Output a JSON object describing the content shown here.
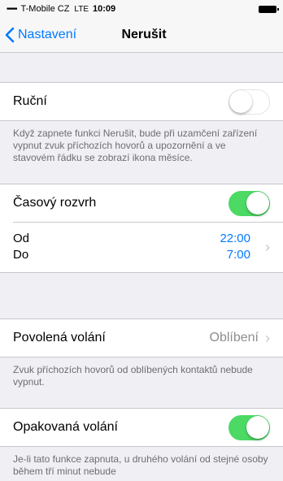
{
  "status_bar": {
    "signal": "•••••",
    "carrier": "T-Mobile CZ",
    "network": "LTE",
    "time": "10:09"
  },
  "nav": {
    "back_label": "Nastavení",
    "title": "Nerušit"
  },
  "manual": {
    "label": "Ruční",
    "enabled": false,
    "footer": "Když zapnete funkci Nerušit, bude při uzamčení zařízení vypnut zvuk příchozích hovorů a upozornění a ve stavovém řádku se zobrazí ikona měsíce."
  },
  "schedule": {
    "label": "Časový rozvrh",
    "enabled": true,
    "from_label": "Od",
    "to_label": "Do",
    "from_value": "22:00",
    "to_value": "7:00"
  },
  "allowed_calls": {
    "label": "Povolená volání",
    "value": "Oblíbení",
    "footer": "Zvuk příchozích hovorů od oblíbených kontaktů nebude vypnut."
  },
  "repeated_calls": {
    "label": "Opakovaná volání",
    "enabled": true,
    "footer": "Je-li tato funkce zapnuta, u druhého volání od stejné osoby během tří minut nebude"
  },
  "colors": {
    "accent": "#007aff",
    "toggle_on": "#4cd964",
    "background": "#efeff4"
  }
}
